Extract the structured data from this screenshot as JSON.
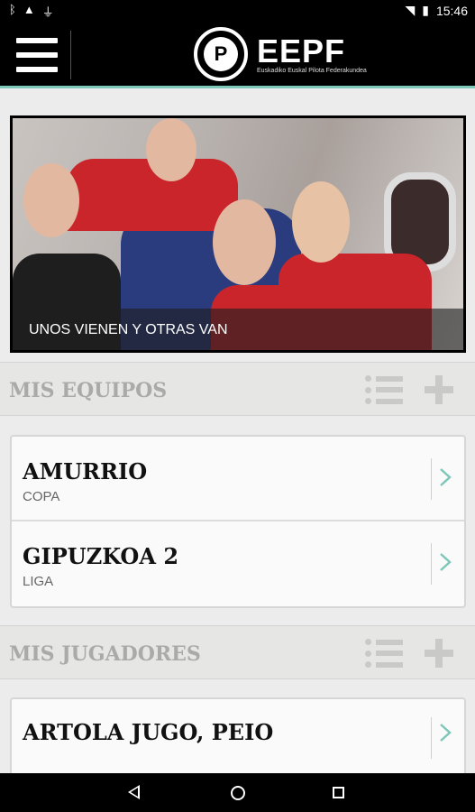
{
  "status_bar": {
    "time": "15:46",
    "left_icons": [
      "bluetooth-icon",
      "warning-icon",
      "usb-icon"
    ],
    "right_icons": [
      "wifi-icon",
      "battery-icon"
    ]
  },
  "app_bar": {
    "logo_title": "EEPF",
    "logo_subtitle": "Euskadiko Euskal Pilota Federakundea"
  },
  "hero": {
    "caption": "UNOS VIENEN Y OTRAS VAN"
  },
  "teams_section": {
    "title": "MIS EQUIPOS",
    "items": [
      {
        "name": "AMURRIO",
        "type": "COPA"
      },
      {
        "name": "GIPUZKOA 2",
        "type": "LIGA"
      }
    ]
  },
  "players_section": {
    "title": "MIS JUGADORES",
    "items": [
      {
        "name": "ARTOLA JUGO, PEIO"
      }
    ]
  },
  "colors": {
    "accent": "#7fc7b9",
    "header_text": "#aaaaaa",
    "icon_gray": "#c9c9c7"
  }
}
